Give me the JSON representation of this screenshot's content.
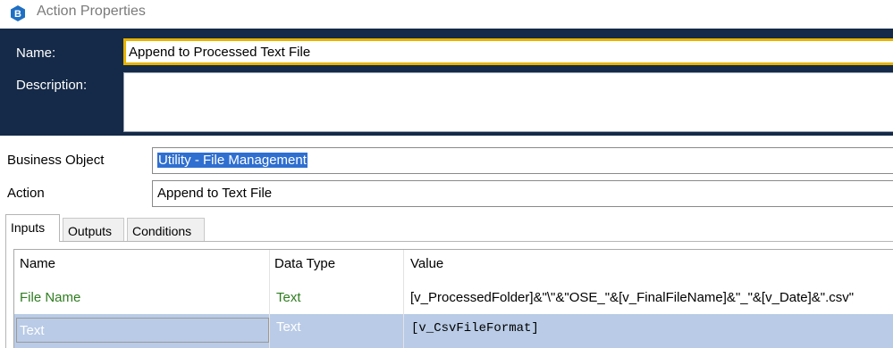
{
  "window": {
    "title": "Action Properties",
    "icon": "blueprism-logo-icon"
  },
  "header": {
    "name_label": "Name:",
    "name_value": "Append to Processed Text File",
    "description_label": "Description:",
    "description_value": ""
  },
  "form": {
    "business_object_label": "Business Object",
    "business_object_value": "Utility - File Management",
    "action_label": "Action",
    "action_value": "Append to Text File"
  },
  "tabs": [
    {
      "label": "Inputs",
      "active": true
    },
    {
      "label": "Outputs",
      "active": false
    },
    {
      "label": "Conditions",
      "active": false
    }
  ],
  "grid": {
    "columns": [
      "Name",
      "Data Type",
      "Value"
    ],
    "rows": [
      {
        "name": "File Name",
        "data_type": "Text",
        "value": "[v_ProcessedFolder]&\"\\\"&\"OSE_\"&[v_FinalFileName]&\"_\"&[v_Date]&\".csv\""
      },
      {
        "name": "Text",
        "data_type": "Text",
        "value": "[v_CsvFileFormat]"
      }
    ]
  },
  "colors": {
    "header_bg": "#152a48",
    "name_focus_border": "#e7b300",
    "selection_highlight": "#2f6fd0",
    "selected_row_bg": "#b9cbe6",
    "input_name_color": "#2e7d1f"
  }
}
